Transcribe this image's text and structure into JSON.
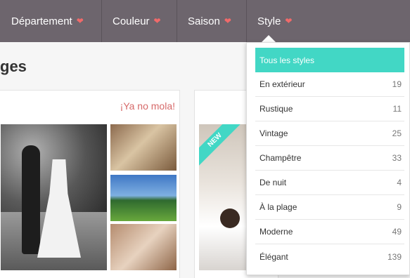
{
  "nav": {
    "items": [
      {
        "label": "Département",
        "heart": "❤"
      },
      {
        "label": "Couleur",
        "heart": "❤"
      },
      {
        "label": "Saison",
        "heart": "❤"
      },
      {
        "label": "Style",
        "heart": "❤"
      }
    ]
  },
  "page": {
    "title": "ges"
  },
  "cards": {
    "card1_link": "¡Ya no mola!",
    "card2_badge": "NEW"
  },
  "dropdown": {
    "items": [
      {
        "label": "Tous les styles",
        "count": ""
      },
      {
        "label": "En extérieur",
        "count": "19"
      },
      {
        "label": "Rustique",
        "count": "11"
      },
      {
        "label": "Vintage",
        "count": "25"
      },
      {
        "label": "Champêtre",
        "count": "33"
      },
      {
        "label": "De nuit",
        "count": "4"
      },
      {
        "label": "À la plage",
        "count": "9"
      },
      {
        "label": "Moderne",
        "count": "49"
      },
      {
        "label": "Élégant",
        "count": "139"
      }
    ]
  },
  "colors": {
    "nav_bg": "#6d656d",
    "accent": "#42d7c5",
    "heart": "#f06a6a",
    "link": "#d66a6a"
  },
  "icons": {
    "nav_heart": "heart-icon"
  }
}
